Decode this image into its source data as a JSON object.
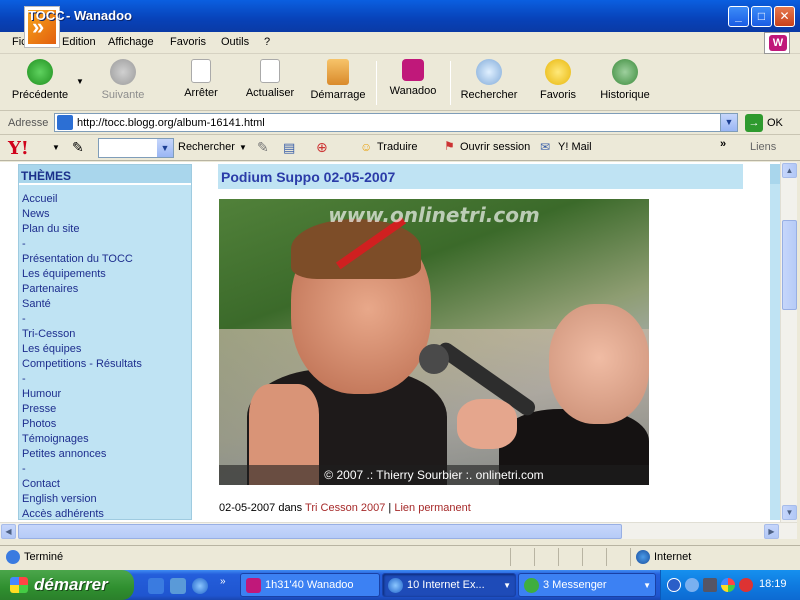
{
  "window": {
    "title_prefix": "TOCC",
    "title": " - Wanadoo",
    "min": "_",
    "max": "□",
    "close": "✕"
  },
  "menu": [
    "Fichier",
    "Edition",
    "Affichage",
    "Favoris",
    "Outils",
    "?"
  ],
  "toolbar": {
    "back": "Précédente",
    "forward": "Suivante",
    "stop": "Arrêter",
    "refresh": "Actualiser",
    "home": "Démarrage",
    "wanadoo": "Wanadoo",
    "search": "Rechercher",
    "favorites": "Favoris",
    "history": "Historique"
  },
  "address": {
    "label": "Adresse",
    "url": "http://tocc.blogg.org/album-16141.html",
    "go": "OK"
  },
  "yahoo": {
    "logo": "Y!",
    "search_value": "",
    "search_button": "Rechercher",
    "translate": "Traduire",
    "open_session": "Ouvrir session",
    "mail": "Y! Mail",
    "more": "»",
    "links": "Liens"
  },
  "sidebar": {
    "heading": "THÈMES",
    "items": [
      "Accueil",
      "News",
      "Plan du site",
      "-",
      "Présentation du TOCC",
      "Les équipements",
      "Partenaires",
      "Santé",
      "-",
      "Tri-Cesson",
      "Les équipes",
      "Competitions - Résultats",
      "-",
      "Humour",
      "Presse",
      "Photos",
      "Témoignages",
      "Petites annonces",
      "-",
      "Contact",
      "English version",
      "Accès adhérents"
    ]
  },
  "post": {
    "title": "Podium Suppo 02-05-2007",
    "photo_watermark": "www.onlinetri.com",
    "photo_caption": "© 2007 .: Thierry Sourbier :. onlinetri.com",
    "meta_date": "02-05-2007 dans ",
    "meta_category": "Tri Cesson 2007",
    "meta_sep": " | ",
    "meta_permalink": "Lien permanent"
  },
  "status": {
    "text": "Terminé",
    "zone": "Internet"
  },
  "taskbar": {
    "start": "démarrer",
    "tasks": [
      "1h31'40 Wanadoo",
      "10 Internet Ex...",
      "3 Messenger"
    ],
    "clock": "18:19"
  }
}
